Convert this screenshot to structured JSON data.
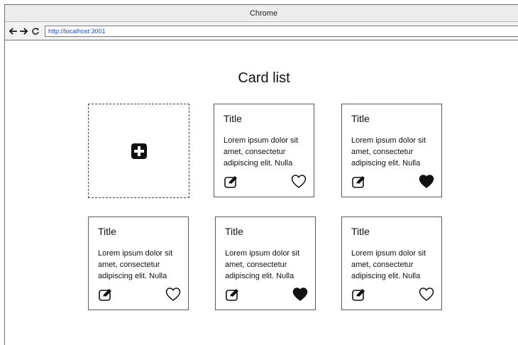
{
  "window": {
    "title": "Chrome"
  },
  "toolbar": {
    "url": "http://localhost:3001"
  },
  "page": {
    "title": "Card list"
  },
  "cards": [
    {
      "title": "Title",
      "body": "Lorem ipsum dolor sit amet, consectetur adipiscing elit. Nulla",
      "liked": false
    },
    {
      "title": "Title",
      "body": "Lorem ipsum dolor sit amet, consectetur adipiscing elit. Nulla",
      "liked": true
    },
    {
      "title": "Title",
      "body": "Lorem ipsum dolor sit amet, consectetur adipiscing elit. Nulla",
      "liked": false
    },
    {
      "title": "Title",
      "body": "Lorem ipsum dolor sit amet, consectetur adipiscing elit. Nulla",
      "liked": true
    },
    {
      "title": "Title",
      "body": "Lorem ipsum dolor sit amet, consectetur adipiscing elit. Nulla",
      "liked": false
    }
  ],
  "icons": {
    "back": "arrow-left-icon",
    "forward": "arrow-right-icon",
    "reload": "reload-icon",
    "add": "plus-square-icon",
    "edit": "edit-icon",
    "like": "heart-icon"
  }
}
